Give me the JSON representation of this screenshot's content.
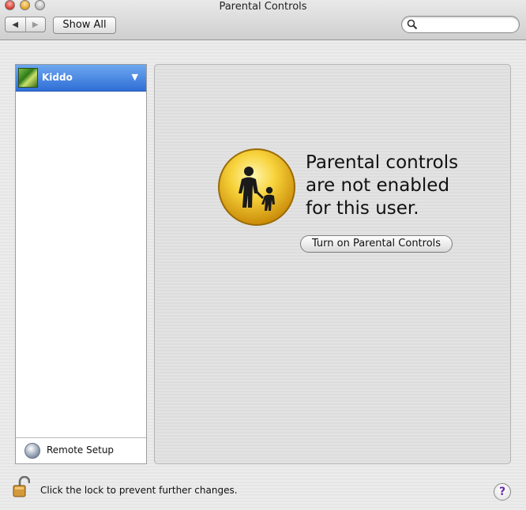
{
  "window": {
    "title": "Parental Controls"
  },
  "toolbar": {
    "back_icon": "back-arrow-icon",
    "forward_icon": "forward-arrow-icon",
    "show_all_label": "Show All",
    "search_placeholder": ""
  },
  "sidebar": {
    "users": [
      {
        "name": "Kiddo",
        "selected": true
      }
    ],
    "footer_label": "Remote Setup"
  },
  "main": {
    "message_lines": [
      "Parental controls",
      "are not enabled",
      "for this user."
    ],
    "button_label": "Turn on Parental Controls"
  },
  "footer": {
    "lock_text": "Click the lock to prevent further changes.",
    "help_label": "?"
  },
  "colors": {
    "selection_blue": "#3b78dc",
    "badge_yellow": "#f2c21b",
    "help_purple": "#6a2aa8"
  }
}
